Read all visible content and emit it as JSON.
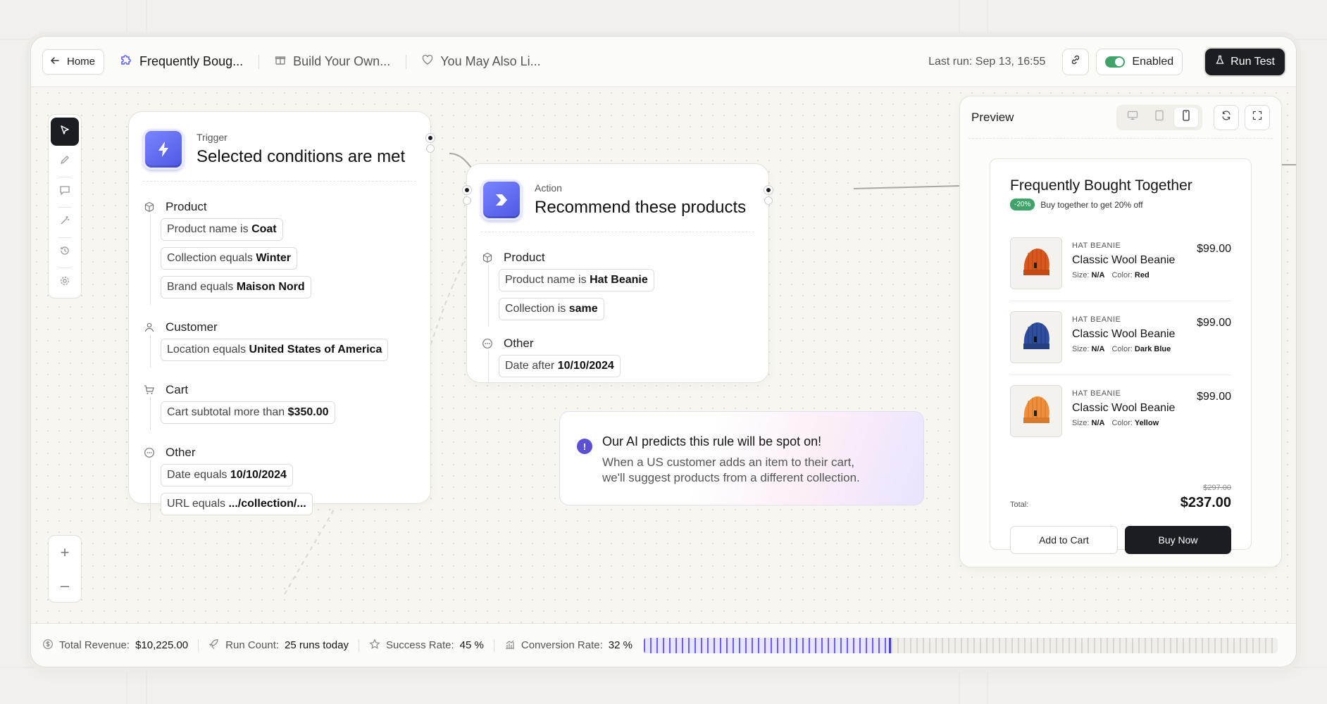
{
  "topbar": {
    "home_label": "Home",
    "tabs": [
      {
        "label": "Frequently Boug...",
        "icon": "puzzle-icon"
      },
      {
        "label": "Build Your Own...",
        "icon": "gift-icon"
      },
      {
        "label": "You May Also Li...",
        "icon": "heart-icon"
      }
    ],
    "last_run": "Last run: Sep 13, 16:55",
    "enabled_label": "Enabled",
    "run_test_label": "Run Test"
  },
  "trigger": {
    "kicker": "Trigger",
    "title": "Selected conditions are met",
    "groups": [
      {
        "title": "Product",
        "icon": "cube-icon",
        "conditions": [
          {
            "text": "Product name is",
            "value": "Coat"
          },
          {
            "text": "Collection equals",
            "value": "Winter"
          },
          {
            "text": "Brand equals",
            "value": "Maison Nord"
          }
        ]
      },
      {
        "title": "Customer",
        "icon": "user-icon",
        "conditions": [
          {
            "text": "Location equals",
            "value": "United States of America"
          }
        ]
      },
      {
        "title": "Cart",
        "icon": "cart-icon",
        "conditions": [
          {
            "text": "Cart subtotal more than",
            "value": "$350.00"
          }
        ]
      },
      {
        "title": "Other",
        "icon": "more-icon",
        "conditions": [
          {
            "text": "Date equals",
            "value": "10/10/2024"
          },
          {
            "text": "URL equals",
            "value": ".../collection/..."
          }
        ]
      }
    ]
  },
  "action": {
    "kicker": "Action",
    "title": "Recommend these products",
    "groups": [
      {
        "title": "Product",
        "icon": "cube-icon",
        "conditions": [
          {
            "text": "Product name is",
            "value": "Hat Beanie"
          },
          {
            "text": "Collection is",
            "value": "same"
          }
        ]
      },
      {
        "title": "Other",
        "icon": "more-icon",
        "conditions": [
          {
            "text": "Date after",
            "value": "10/10/2024"
          }
        ]
      }
    ]
  },
  "ai": {
    "icon": "!",
    "title": "Our AI predicts this rule will be spot on!",
    "body_line1": "When a US customer adds an item to their cart,",
    "body_line2": "we'll suggest products from a different collection."
  },
  "preview": {
    "title": "Preview",
    "widget": {
      "title": "Frequently Bought Together",
      "badge": "-20%",
      "subtitle": "Buy together to get 20% off",
      "products": [
        {
          "category": "HAT BEANIE",
          "name": "Classic Wool Beanie",
          "price": "$99.00",
          "size_label": "Size:",
          "size": "N/A",
          "color_label": "Color:",
          "color": "Red",
          "swatch": "#d9581f"
        },
        {
          "category": "HAT BEANIE",
          "name": "Classic Wool Beanie",
          "price": "$99.00",
          "size_label": "Size:",
          "size": "N/A",
          "color_label": "Color:",
          "color": "Dark Blue",
          "swatch": "#2f4f9e"
        },
        {
          "category": "HAT BEANIE",
          "name": "Classic Wool Beanie",
          "price": "$99.00",
          "size_label": "Size:",
          "size": "N/A",
          "color_label": "Color:",
          "color": "Yellow",
          "swatch": "#ee8f3c"
        }
      ],
      "total_label": "Total:",
      "old_total": "$297.00",
      "total": "$237.00",
      "add_to_cart": "Add to Cart",
      "buy_now": "Buy Now"
    }
  },
  "footer": {
    "revenue_label": "Total Revenue:",
    "revenue": "$10,225.00",
    "runs_label": "Run Count:",
    "runs": "25 runs today",
    "success_label": "Success Rate:",
    "success": "45 %",
    "conversion_label": "Conversion Rate:",
    "conversion": "32 %",
    "conversion_fraction": 0.39
  },
  "colors": {
    "accent": "#5b5ee8",
    "dark": "#1b1d22",
    "success": "#3fa36a"
  }
}
